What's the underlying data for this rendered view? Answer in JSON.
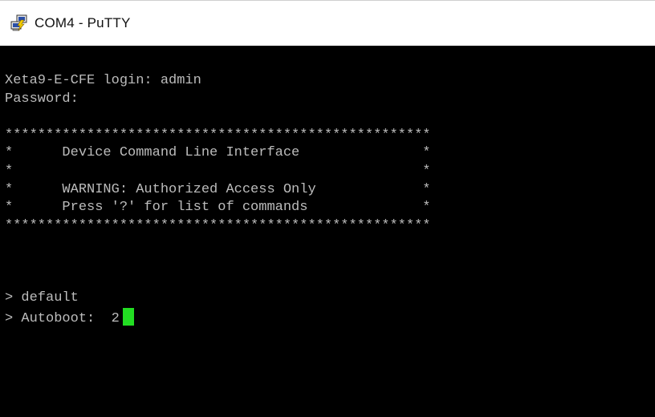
{
  "window": {
    "title": "COM4 - PuTTY",
    "app_icon": "putty-icon"
  },
  "terminal": {
    "background": "#000000",
    "foreground": "#bcbcbc",
    "cursor_color": "#22dd22",
    "lines": [
      "Xeta9-E-CFE login: admin",
      "Password:",
      "",
      "****************************************************",
      "*      Device Command Line Interface               *",
      "*                                                  *",
      "*      WARNING: Authorized Access Only             *",
      "*      Press '?' for list of commands              *",
      "****************************************************",
      "",
      "",
      "",
      "> default",
      "> Autoboot:  2"
    ]
  }
}
